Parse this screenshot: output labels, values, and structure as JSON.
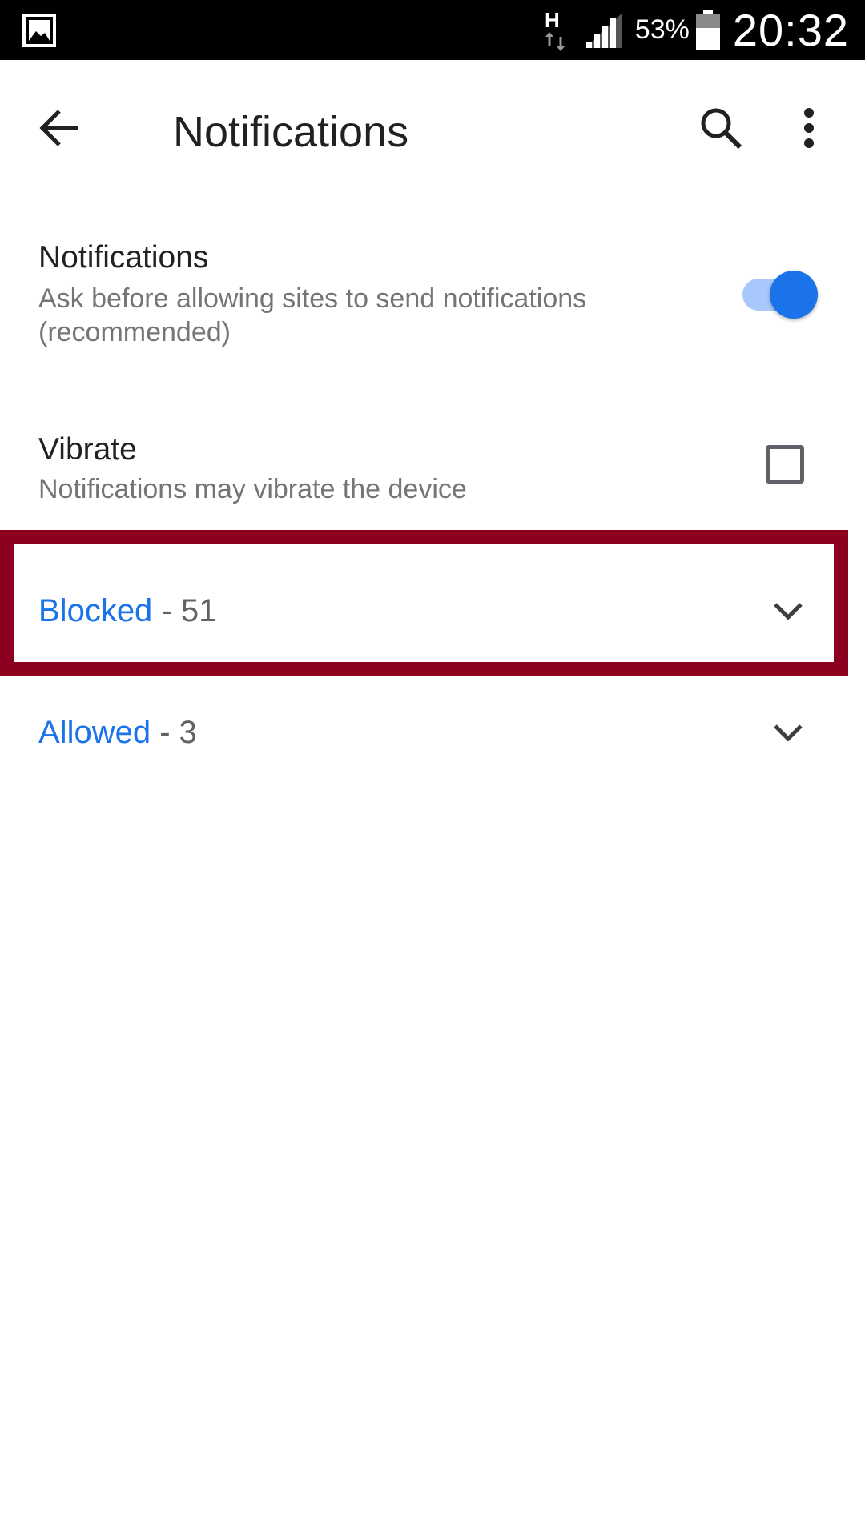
{
  "status_bar": {
    "battery_percent": "53%",
    "time": "20:32",
    "network_type": "H",
    "icons": [
      "gallery-icon",
      "network-h-icon",
      "signal-icon",
      "battery-icon"
    ]
  },
  "toolbar": {
    "title": "Notifications",
    "icons": [
      "back-arrow-icon",
      "search-icon",
      "more-vert-icon"
    ]
  },
  "settings": {
    "notifications": {
      "title": "Notifications",
      "summary": "Ask before allowing sites to send notifications (recommended)",
      "enabled": true
    },
    "vibrate": {
      "title": "Vibrate",
      "summary": "Notifications may vibrate the device",
      "checked": false
    }
  },
  "groups": [
    {
      "name": "Blocked",
      "separator": " - ",
      "count": "51",
      "icon": "chevron-down-icon"
    },
    {
      "name": "Allowed",
      "separator": " - ",
      "count": "3",
      "icon": "chevron-down-icon"
    }
  ],
  "colors": {
    "accent": "#1a73e8",
    "toggle_track": "#a8c7fa",
    "highlight_border": "#8b001e",
    "status_bar": "#000000"
  }
}
